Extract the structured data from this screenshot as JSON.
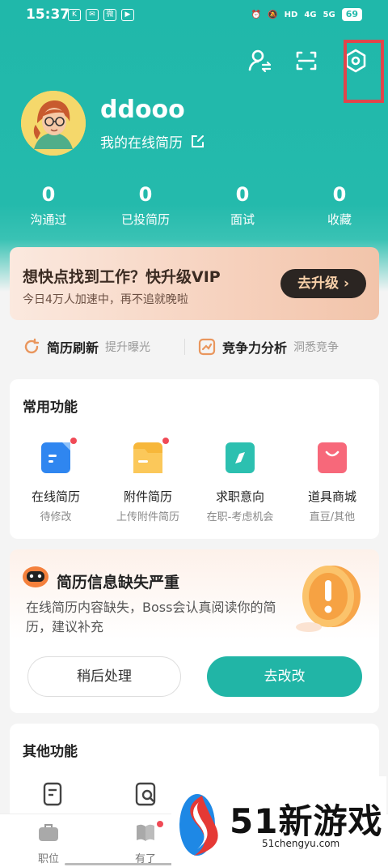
{
  "status_bar": {
    "time": "15:37",
    "notif_icons": [
      "K",
      "✉",
      "微",
      "▶"
    ],
    "net1": "HD",
    "net2": "4G",
    "net3": "5G",
    "battery": "69"
  },
  "profile": {
    "name": "ddooo",
    "resume_link": "我的在线简历"
  },
  "stats": [
    {
      "num": "0",
      "label": "沟通过"
    },
    {
      "num": "0",
      "label": "已投简历"
    },
    {
      "num": "0",
      "label": "面试"
    },
    {
      "num": "0",
      "label": "收藏"
    }
  ],
  "vip": {
    "title": "想快点找到工作？快升级VIP",
    "subtitle": "今日4万人加速中，再不追就晚啦",
    "button": "去升级"
  },
  "quick": [
    {
      "main": "简历刷新",
      "hint": "提升曝光"
    },
    {
      "main": "竞争力分析",
      "hint": "洞悉竞争"
    }
  ],
  "common": {
    "title": "常用功能",
    "items": [
      {
        "name": "在线简历",
        "desc": "待修改"
      },
      {
        "name": "附件简历",
        "desc": "上传附件简历"
      },
      {
        "name": "求职意向",
        "desc": "在职-考虑机会"
      },
      {
        "name": "道具商城",
        "desc": "直豆/其他"
      }
    ]
  },
  "warning": {
    "title": "简历信息缺失严重",
    "body": "在线简历内容缺失，Boss会认真阅读你的简历，建议补充",
    "later": "稍后处理",
    "go": "去改改"
  },
  "other": {
    "title": "其他功能"
  },
  "tabs": [
    {
      "label": "职位"
    },
    {
      "label": "有了"
    }
  ],
  "watermark": {
    "big": "51新游戏",
    "small": "51chengyu.com"
  },
  "colors": {
    "teal": "#24baac",
    "highlight": "#e0454b",
    "vip_btn": "#2b2522"
  }
}
